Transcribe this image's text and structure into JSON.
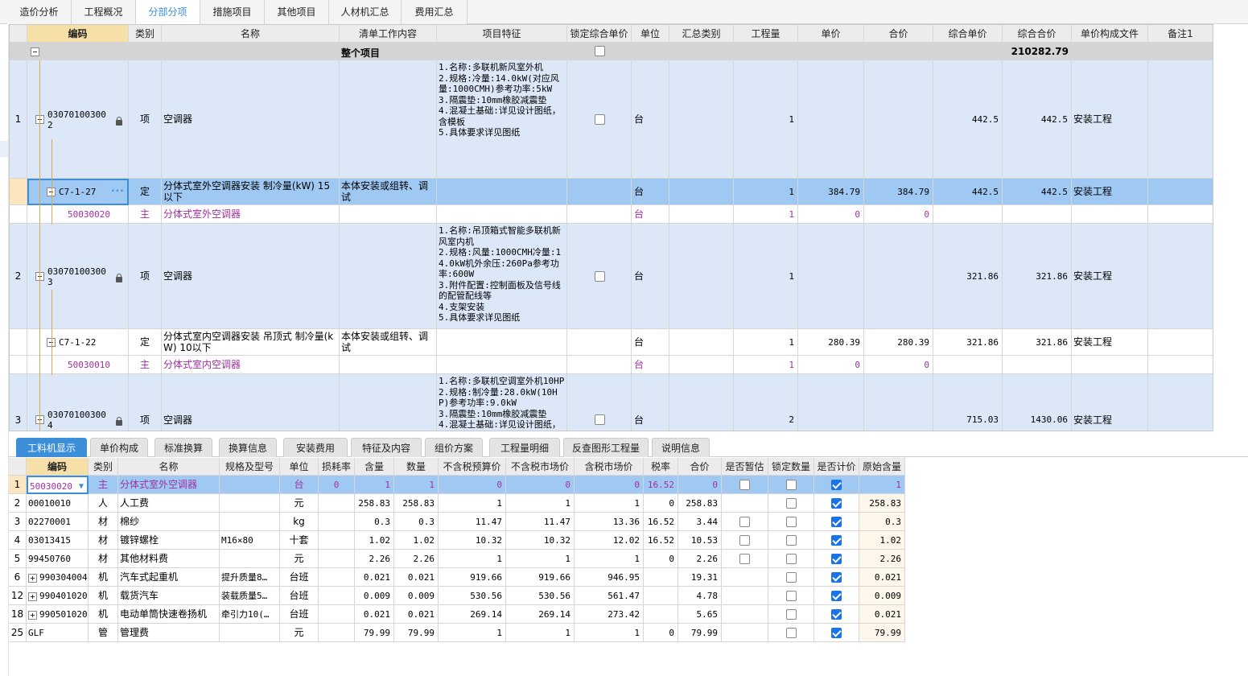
{
  "tabs": [
    "造价分析",
    "工程概况",
    "分部分项",
    "措施项目",
    "其他项目",
    "人材机汇总",
    "费用汇总"
  ],
  "upper": {
    "headers": [
      "编码",
      "类别",
      "名称",
      "清单工作内容",
      "项目特征",
      "锁定综合单价",
      "单位",
      "汇总类别",
      "工程量",
      "单价",
      "合价",
      "综合单价",
      "综合合价",
      "单价构成文件",
      "备注1"
    ],
    "group": {
      "label": "整个项目",
      "total": "210282.79"
    },
    "rows": [
      {
        "idx": "1",
        "code": "03070100300 2",
        "type": "项",
        "name": "空调器",
        "work": "",
        "feature": "1.名称:多联机新风室外机\n2.规格:冷量:14.0kW(对应风量:1000CMH)参考功率:5kW\n3.隔震垫:10mm橡胶减震垫\n4.混凝土基础:详见设计图纸，含模板\n5.具体要求详见图纸",
        "unit": "台",
        "qty": "1",
        "price": "",
        "sum": "",
        "cprice": "442.5",
        "csum": "442.5",
        "file": "安装工程"
      },
      {
        "idx": "",
        "code": "C7-1-27",
        "type": "定",
        "name": "分体式室外空调器安装 制冷量(kW) 15以下",
        "work": "本体安装或组转、调试",
        "feature": "",
        "unit": "台",
        "qty": "1",
        "price": "384.79",
        "sum": "384.79",
        "cprice": "442.5",
        "csum": "442.5",
        "file": "安装工程"
      },
      {
        "idx": "",
        "code": "50030020",
        "type": "主",
        "name": "分体式室外空调器",
        "work": "",
        "feature": "",
        "unit": "台",
        "qty": "1",
        "price": "0",
        "sum": "0",
        "cprice": "",
        "csum": "",
        "file": ""
      },
      {
        "idx": "2",
        "code": "03070100300 3",
        "type": "项",
        "name": "空调器",
        "work": "",
        "feature": "1.名称:吊顶箱式智能多联机新风室内机\n2.规格:风量:1000CMH冷量:14.0kW机外余压:260Pa参考功率:600W\n3.附件配置:控制面板及信号线的配管配线等\n4.支架安装\n5.具体要求详见图纸",
        "unit": "台",
        "qty": "1",
        "price": "",
        "sum": "",
        "cprice": "321.86",
        "csum": "321.86",
        "file": "安装工程"
      },
      {
        "idx": "",
        "code": "C7-1-22",
        "type": "定",
        "name": "分体式室内空调器安装 吊顶式 制冷量(kW) 10以下",
        "work": "本体安装或组转、调试",
        "feature": "",
        "unit": "台",
        "qty": "1",
        "price": "280.39",
        "sum": "280.39",
        "cprice": "321.86",
        "csum": "321.86",
        "file": "安装工程"
      },
      {
        "idx": "",
        "code": "50030010",
        "type": "主",
        "name": "分体式室内空调器",
        "work": "",
        "feature": "",
        "unit": "台",
        "qty": "1",
        "price": "0",
        "sum": "0",
        "cprice": "",
        "csum": "",
        "file": ""
      },
      {
        "idx": "3",
        "code": "03070100300 4",
        "type": "项",
        "name": "空调器",
        "work": "",
        "feature": "1.名称:多联机空调室外机10HP\n2.规格:制冷量:28.0kW(10HP)参考功率:9.0kW\n3.隔震垫:10mm橡胶减震垫\n4.混凝土基础:详见设计图纸，含模板\n5.具体要求详见图纸",
        "unit": "台",
        "qty": "2",
        "price": "",
        "sum": "",
        "cprice": "715.03",
        "csum": "1430.06",
        "file": "安装工程"
      }
    ]
  },
  "bottom_tabs": [
    "工料机显示",
    "单价构成",
    "标准换算",
    "换算信息",
    "安装费用",
    "特征及内容",
    "组价方案",
    "工程量明细",
    "反查图形工程量",
    "说明信息"
  ],
  "lower": {
    "headers": [
      "编码",
      "类别",
      "名称",
      "规格及型号",
      "单位",
      "损耗率",
      "含量",
      "数量",
      "不含税预算价",
      "不含税市场价",
      "含税市场价",
      "税率",
      "合价",
      "是否暂估",
      "锁定数量",
      "是否计价",
      "原始含量"
    ],
    "rows": [
      {
        "idx": "1",
        "code": "50030020",
        "type": "主",
        "name": "分体式室外空调器",
        "spec": "",
        "unit": "台",
        "loss": "0",
        "content": "1",
        "qty": "1",
        "p1": "0",
        "p2": "0",
        "p3": "0",
        "tax": "16.52",
        "sum": "0",
        "est": "box",
        "lock": "box",
        "calc": "on",
        "orig": "1"
      },
      {
        "idx": "2",
        "code": "00010010",
        "type": "人",
        "name": "人工费",
        "spec": "",
        "unit": "元",
        "loss": "",
        "content": "258.83",
        "qty": "258.83",
        "p1": "1",
        "p2": "1",
        "p3": "1",
        "tax": "0",
        "sum": "258.83",
        "est": "",
        "lock": "box",
        "calc": "on",
        "orig": "258.83"
      },
      {
        "idx": "3",
        "code": "02270001",
        "type": "材",
        "name": "棉纱",
        "spec": "",
        "unit": "kg",
        "loss": "",
        "content": "0.3",
        "qty": "0.3",
        "p1": "11.47",
        "p2": "11.47",
        "p3": "13.36",
        "tax": "16.52",
        "sum": "3.44",
        "est": "box",
        "lock": "box",
        "calc": "on",
        "orig": "0.3"
      },
      {
        "idx": "4",
        "code": "03013415",
        "type": "材",
        "name": "镀锌螺栓",
        "spec": "M16×80",
        "unit": "十套",
        "loss": "",
        "content": "1.02",
        "qty": "1.02",
        "p1": "10.32",
        "p2": "10.32",
        "p3": "12.02",
        "tax": "16.52",
        "sum": "10.53",
        "est": "box",
        "lock": "box",
        "calc": "on",
        "orig": "1.02"
      },
      {
        "idx": "5",
        "code": "99450760",
        "type": "材",
        "name": "其他材料费",
        "spec": "",
        "unit": "元",
        "loss": "",
        "content": "2.26",
        "qty": "2.26",
        "p1": "1",
        "p2": "1",
        "p3": "1",
        "tax": "0",
        "sum": "2.26",
        "est": "box",
        "lock": "box",
        "calc": "on",
        "orig": "2.26"
      },
      {
        "idx": "6",
        "code": "990304004",
        "type": "机",
        "name": "汽车式起重机",
        "spec": "提升质量8…",
        "unit": "台班",
        "loss": "",
        "content": "0.021",
        "qty": "0.021",
        "p1": "919.66",
        "p2": "919.66",
        "p3": "946.95",
        "tax": "",
        "sum": "19.31",
        "est": "",
        "lock": "box",
        "calc": "on",
        "orig": "0.021",
        "plus": true
      },
      {
        "idx": "12",
        "code": "990401020",
        "type": "机",
        "name": "载货汽车",
        "spec": "装载质量5…",
        "unit": "台班",
        "loss": "",
        "content": "0.009",
        "qty": "0.009",
        "p1": "530.56",
        "p2": "530.56",
        "p3": "561.47",
        "tax": "",
        "sum": "4.78",
        "est": "",
        "lock": "box",
        "calc": "on",
        "orig": "0.009",
        "plus": true
      },
      {
        "idx": "18",
        "code": "990501020",
        "type": "机",
        "name": "电动单筒快速卷扬机",
        "spec": "牵引力10(…",
        "unit": "台班",
        "loss": "",
        "content": "0.021",
        "qty": "0.021",
        "p1": "269.14",
        "p2": "269.14",
        "p3": "273.42",
        "tax": "",
        "sum": "5.65",
        "est": "",
        "lock": "box",
        "calc": "on",
        "orig": "0.021",
        "plus": true
      },
      {
        "idx": "25",
        "code": "GLF",
        "type": "管",
        "name": "管理费",
        "spec": "",
        "unit": "元",
        "loss": "",
        "content": "79.99",
        "qty": "79.99",
        "p1": "1",
        "p2": "1",
        "p3": "1",
        "tax": "0",
        "sum": "79.99",
        "est": "",
        "lock": "box",
        "calc": "on",
        "orig": "79.99"
      }
    ]
  },
  "colors": {
    "accent": "#3b8fd9",
    "row_blue": "#dce8f8",
    "row_selected": "#9fc9f3",
    "main_material": "#a030a0",
    "group_bg": "#d4d4d4"
  }
}
